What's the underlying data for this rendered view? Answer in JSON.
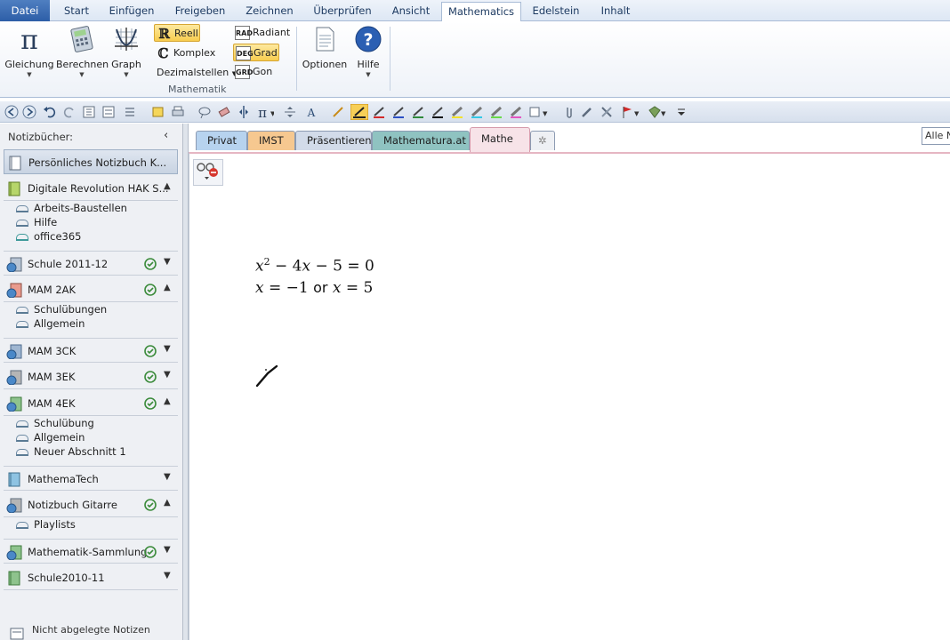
{
  "ribbon_tabs": [
    "Datei",
    "Start",
    "Einfügen",
    "Freigeben",
    "Zeichnen",
    "Überprüfen",
    "Ansicht",
    "Mathematics",
    "Edelstein",
    "Inhalt"
  ],
  "ribbon": {
    "equation_label": "Gleichung",
    "compute_label": "Berechnen",
    "graph_label": "Graph",
    "real_label": "Reell",
    "complex_label": "Komplex",
    "decimals_label": "Dezimalstellen",
    "radian_label": "Radiant",
    "degree_label": "Grad",
    "gon_label": "Gon",
    "rad_badge": "RAD",
    "deg_badge": "DEG",
    "grd_badge": "GRD",
    "group_label": "Mathematik",
    "options_label": "Optionen",
    "help_label": "Hilfe"
  },
  "nav": {
    "header": "Notizbücher:",
    "notebooks": [
      {
        "name": "Persönliches Notizbuch K...",
        "sections": []
      },
      {
        "name": "Digitale Revolution HAK S...",
        "sections": [
          "Arbeits-Baustellen",
          "Hilfe",
          "office365"
        ]
      },
      {
        "name": "Schule 2011-12",
        "sections": []
      },
      {
        "name": "MAM 2AK",
        "sections": [
          "Schulübungen",
          "Allgemein"
        ]
      },
      {
        "name": "MAM 3CK",
        "sections": []
      },
      {
        "name": "MAM 3EK",
        "sections": []
      },
      {
        "name": "MAM 4EK",
        "sections": [
          "Schulübung",
          "Allgemein",
          "Neuer Abschnitt 1"
        ]
      },
      {
        "name": "MathemaTech",
        "sections": []
      },
      {
        "name": "Notizbuch Gitarre",
        "sections": [
          "Playlists"
        ]
      },
      {
        "name": "Mathematik-Sammlung",
        "sections": []
      },
      {
        "name": "Schule2010-11",
        "sections": []
      }
    ],
    "footer": "Nicht abgelegte Notizen"
  },
  "page_tabs": [
    "Privat",
    "IMST",
    "Präsentieren",
    "Mathematura.at",
    "Mathe"
  ],
  "search_placeholder": "Alle N",
  "equation": {
    "line1": {
      "x": "x",
      "exp": "2",
      "minus1": " − 4",
      "x2": "x",
      "rest": " − 5 = 0"
    },
    "line2": {
      "x": "x",
      "eq1": " = −1 ",
      "or": "or",
      "x2": "x",
      "eq2": " = 5"
    }
  },
  "colors": {
    "tab_privat": "#b7d3ef",
    "tab_imst": "#f6c890",
    "tab_praesentieren": "#d2dbe9",
    "tab_mathematura": "#8fc3c1",
    "tab_mathe": "#f7e3e8"
  }
}
